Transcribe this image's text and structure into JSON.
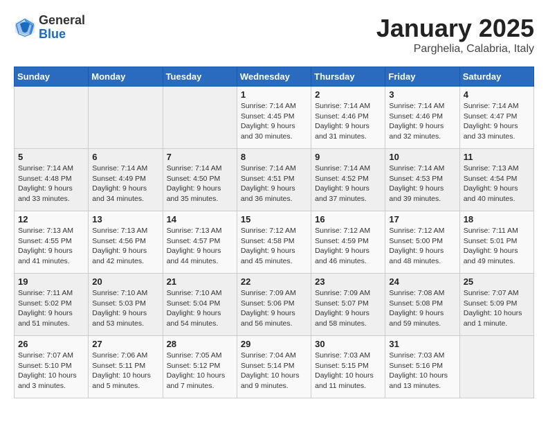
{
  "header": {
    "logo_general": "General",
    "logo_blue": "Blue",
    "month_title": "January 2025",
    "location": "Parghelia, Calabria, Italy"
  },
  "days_of_week": [
    "Sunday",
    "Monday",
    "Tuesday",
    "Wednesday",
    "Thursday",
    "Friday",
    "Saturday"
  ],
  "weeks": [
    [
      {
        "day": "",
        "info": ""
      },
      {
        "day": "",
        "info": ""
      },
      {
        "day": "",
        "info": ""
      },
      {
        "day": "1",
        "info": "Sunrise: 7:14 AM\nSunset: 4:45 PM\nDaylight: 9 hours\nand 30 minutes."
      },
      {
        "day": "2",
        "info": "Sunrise: 7:14 AM\nSunset: 4:46 PM\nDaylight: 9 hours\nand 31 minutes."
      },
      {
        "day": "3",
        "info": "Sunrise: 7:14 AM\nSunset: 4:46 PM\nDaylight: 9 hours\nand 32 minutes."
      },
      {
        "day": "4",
        "info": "Sunrise: 7:14 AM\nSunset: 4:47 PM\nDaylight: 9 hours\nand 33 minutes."
      }
    ],
    [
      {
        "day": "5",
        "info": "Sunrise: 7:14 AM\nSunset: 4:48 PM\nDaylight: 9 hours\nand 33 minutes."
      },
      {
        "day": "6",
        "info": "Sunrise: 7:14 AM\nSunset: 4:49 PM\nDaylight: 9 hours\nand 34 minutes."
      },
      {
        "day": "7",
        "info": "Sunrise: 7:14 AM\nSunset: 4:50 PM\nDaylight: 9 hours\nand 35 minutes."
      },
      {
        "day": "8",
        "info": "Sunrise: 7:14 AM\nSunset: 4:51 PM\nDaylight: 9 hours\nand 36 minutes."
      },
      {
        "day": "9",
        "info": "Sunrise: 7:14 AM\nSunset: 4:52 PM\nDaylight: 9 hours\nand 37 minutes."
      },
      {
        "day": "10",
        "info": "Sunrise: 7:14 AM\nSunset: 4:53 PM\nDaylight: 9 hours\nand 39 minutes."
      },
      {
        "day": "11",
        "info": "Sunrise: 7:13 AM\nSunset: 4:54 PM\nDaylight: 9 hours\nand 40 minutes."
      }
    ],
    [
      {
        "day": "12",
        "info": "Sunrise: 7:13 AM\nSunset: 4:55 PM\nDaylight: 9 hours\nand 41 minutes."
      },
      {
        "day": "13",
        "info": "Sunrise: 7:13 AM\nSunset: 4:56 PM\nDaylight: 9 hours\nand 42 minutes."
      },
      {
        "day": "14",
        "info": "Sunrise: 7:13 AM\nSunset: 4:57 PM\nDaylight: 9 hours\nand 44 minutes."
      },
      {
        "day": "15",
        "info": "Sunrise: 7:12 AM\nSunset: 4:58 PM\nDaylight: 9 hours\nand 45 minutes."
      },
      {
        "day": "16",
        "info": "Sunrise: 7:12 AM\nSunset: 4:59 PM\nDaylight: 9 hours\nand 46 minutes."
      },
      {
        "day": "17",
        "info": "Sunrise: 7:12 AM\nSunset: 5:00 PM\nDaylight: 9 hours\nand 48 minutes."
      },
      {
        "day": "18",
        "info": "Sunrise: 7:11 AM\nSunset: 5:01 PM\nDaylight: 9 hours\nand 49 minutes."
      }
    ],
    [
      {
        "day": "19",
        "info": "Sunrise: 7:11 AM\nSunset: 5:02 PM\nDaylight: 9 hours\nand 51 minutes."
      },
      {
        "day": "20",
        "info": "Sunrise: 7:10 AM\nSunset: 5:03 PM\nDaylight: 9 hours\nand 53 minutes."
      },
      {
        "day": "21",
        "info": "Sunrise: 7:10 AM\nSunset: 5:04 PM\nDaylight: 9 hours\nand 54 minutes."
      },
      {
        "day": "22",
        "info": "Sunrise: 7:09 AM\nSunset: 5:06 PM\nDaylight: 9 hours\nand 56 minutes."
      },
      {
        "day": "23",
        "info": "Sunrise: 7:09 AM\nSunset: 5:07 PM\nDaylight: 9 hours\nand 58 minutes."
      },
      {
        "day": "24",
        "info": "Sunrise: 7:08 AM\nSunset: 5:08 PM\nDaylight: 9 hours\nand 59 minutes."
      },
      {
        "day": "25",
        "info": "Sunrise: 7:07 AM\nSunset: 5:09 PM\nDaylight: 10 hours\nand 1 minute."
      }
    ],
    [
      {
        "day": "26",
        "info": "Sunrise: 7:07 AM\nSunset: 5:10 PM\nDaylight: 10 hours\nand 3 minutes."
      },
      {
        "day": "27",
        "info": "Sunrise: 7:06 AM\nSunset: 5:11 PM\nDaylight: 10 hours\nand 5 minutes."
      },
      {
        "day": "28",
        "info": "Sunrise: 7:05 AM\nSunset: 5:12 PM\nDaylight: 10 hours\nand 7 minutes."
      },
      {
        "day": "29",
        "info": "Sunrise: 7:04 AM\nSunset: 5:14 PM\nDaylight: 10 hours\nand 9 minutes."
      },
      {
        "day": "30",
        "info": "Sunrise: 7:03 AM\nSunset: 5:15 PM\nDaylight: 10 hours\nand 11 minutes."
      },
      {
        "day": "31",
        "info": "Sunrise: 7:03 AM\nSunset: 5:16 PM\nDaylight: 10 hours\nand 13 minutes."
      },
      {
        "day": "",
        "info": ""
      }
    ]
  ]
}
